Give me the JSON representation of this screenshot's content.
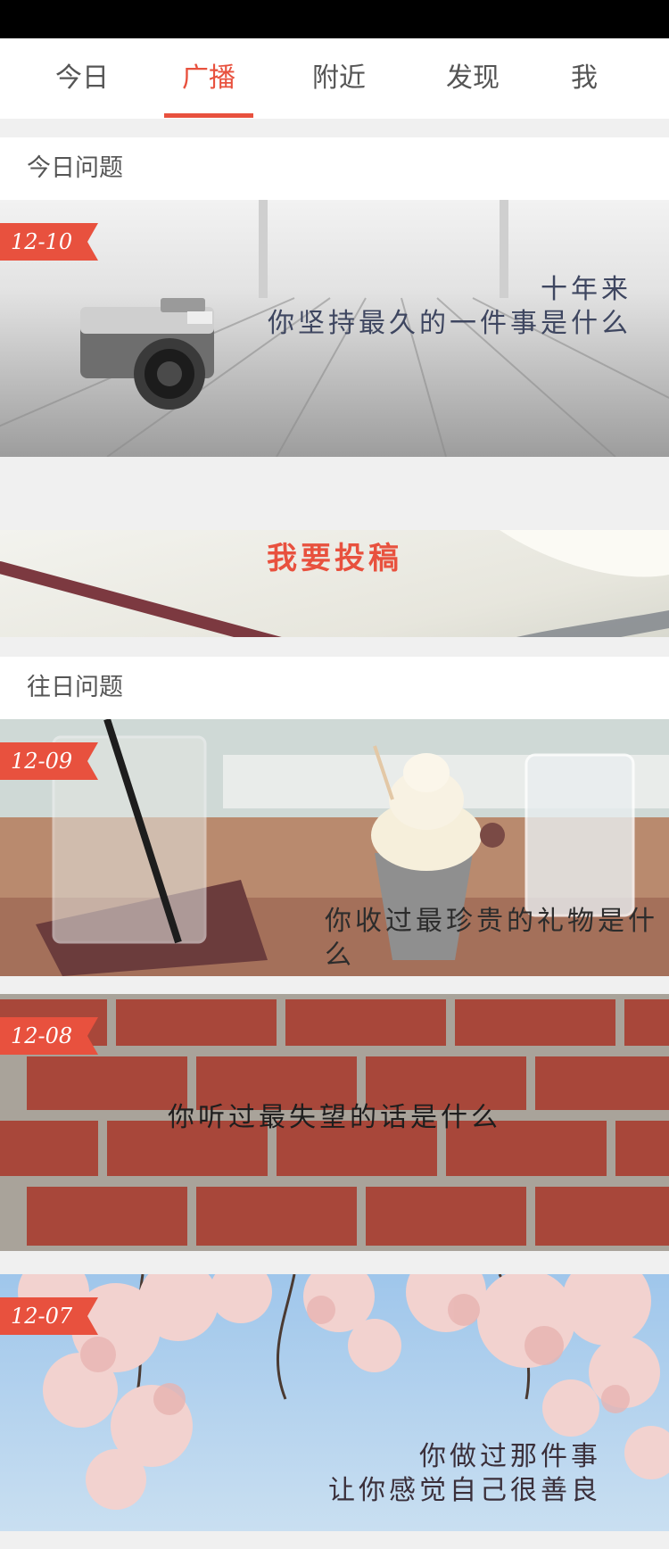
{
  "tabs": [
    {
      "label": "今日"
    },
    {
      "label": "广播"
    },
    {
      "label": "附近"
    },
    {
      "label": "发现"
    },
    {
      "label": "我"
    }
  ],
  "active_tab": "广播",
  "today_section": {
    "title": "今日问题"
  },
  "today_card": {
    "date": "12-10",
    "question_line1": "十年来",
    "question_line2": "你坚持最久的一件事是什么"
  },
  "submit_banner": {
    "label": "我要投稿"
  },
  "past_section": {
    "title": "往日问题"
  },
  "past_cards": [
    {
      "date": "12-09",
      "question_line1": "你收过最珍贵的礼物是什么"
    },
    {
      "date": "12-08",
      "question_line1": "你听过最失望的话是什么"
    },
    {
      "date": "12-07",
      "question_line1": "你做过那件事",
      "question_line2": "让你感觉自己很善良"
    }
  ],
  "colors": {
    "accent": "#e8513e",
    "tab_text": "#555555",
    "background": "#f0f0f0"
  }
}
